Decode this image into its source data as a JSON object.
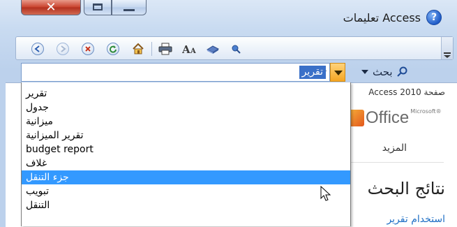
{
  "window": {
    "title": "Access تعليمات",
    "help_icon_glyph": "?",
    "close_glyph": "✕"
  },
  "toolbar": {
    "icons": [
      "back-icon",
      "forward-icon",
      "stop-icon",
      "refresh-icon",
      "home-icon",
      "print-icon",
      "text-size-icon",
      "table-of-contents-icon",
      "keep-on-top-icon"
    ]
  },
  "search": {
    "value": "تقرير",
    "scope_label": "بحث"
  },
  "dropdown": {
    "items": [
      "تقرير",
      "جدول",
      "ميزانية",
      "تقرير الميزانية",
      "budget report",
      "غلاف",
      "جزء التنقل",
      "تبويب",
      "التنقل"
    ],
    "selected_index": 6
  },
  "content": {
    "breadcrumb": "صفحة Access 2010",
    "office_logo_text": "Office",
    "office_logo_sup": "Microsoft®",
    "more_link": "المزيد",
    "results_title": "نتائج البحث",
    "usage_link": "استخدام تقرير"
  },
  "colors": {
    "selection": "#3399ff",
    "dropdown_button": "#f5a623",
    "close_button": "#c9412c"
  }
}
